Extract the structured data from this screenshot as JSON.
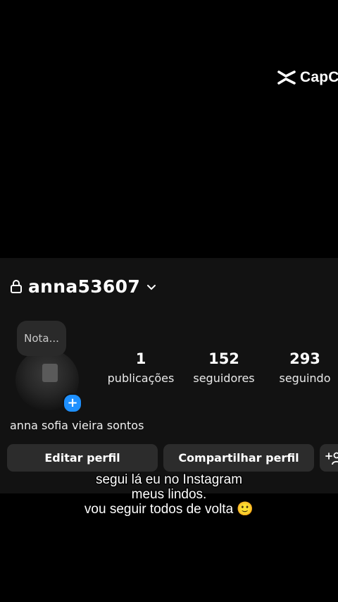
{
  "watermark": {
    "text": "CapC",
    "icon": "capcut-logo-icon"
  },
  "profile": {
    "lock_icon": "lock-icon",
    "username": "anna53607",
    "dropdown_icon": "chevron-down-icon",
    "note_placeholder": "Nota...",
    "add_icon": "plus-icon",
    "full_name": "anna sofia vieira sontos"
  },
  "stats": {
    "posts": {
      "value": "1",
      "label": "publicações"
    },
    "followers": {
      "value": "152",
      "label": "seguidores"
    },
    "following": {
      "value": "293",
      "label": "seguindo"
    }
  },
  "buttons": {
    "edit": "Editar perfil",
    "share": "Compartilhar perfil",
    "add_user_icon": "add-user-icon"
  },
  "caption": {
    "line1": "segui lá eu no Instagram",
    "line2": "meus lindos.",
    "line3": "vou seguir todos de volta 🙂"
  },
  "colors": {
    "background": "#000000",
    "panel": "#121212",
    "button": "#2c2c2c",
    "accent": "#1e90ff"
  }
}
